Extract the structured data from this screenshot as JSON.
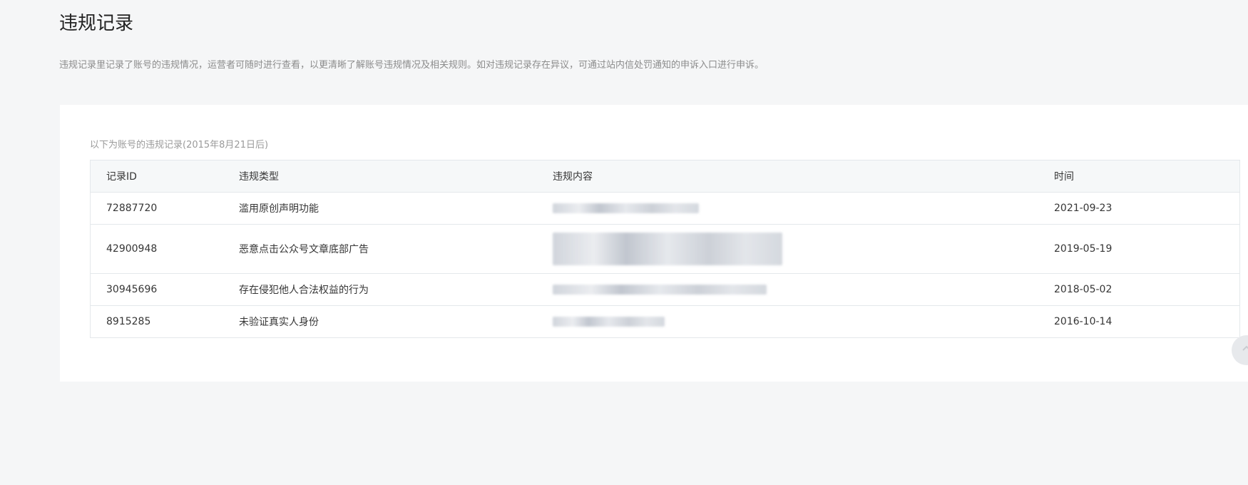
{
  "page": {
    "title": "违规记录",
    "description": "违规记录里记录了账号的违规情况，运营者可随时进行查看，以更清晰了解账号违规情况及相关规则。如对违规记录存在异议，可通过站内信处罚通知的申诉入口进行申诉。"
  },
  "table": {
    "caption": "以下为账号的违规记录(2015年8月21日后)",
    "headers": {
      "id": "记录ID",
      "type": "违规类型",
      "content": "违规内容",
      "time": "时间"
    },
    "rows": [
      {
        "id": "72887720",
        "type": "滥用原创声明功能",
        "time": "2021-09-23"
      },
      {
        "id": "42900948",
        "type": "恶意点击公众号文章底部广告",
        "time": "2019-05-19"
      },
      {
        "id": "30945696",
        "type": "存在侵犯他人合法权益的行为",
        "time": "2018-05-02"
      },
      {
        "id": "8915285",
        "type": "未验证真实人身份",
        "time": "2016-10-14"
      }
    ]
  },
  "icons": {
    "side_button": "scroll-top-icon"
  },
  "colors": {
    "page_bg": "#f5f6f7",
    "card_bg": "#ffffff",
    "link_text": "#2c4f8a",
    "header_bg": "#f6f8f9"
  }
}
